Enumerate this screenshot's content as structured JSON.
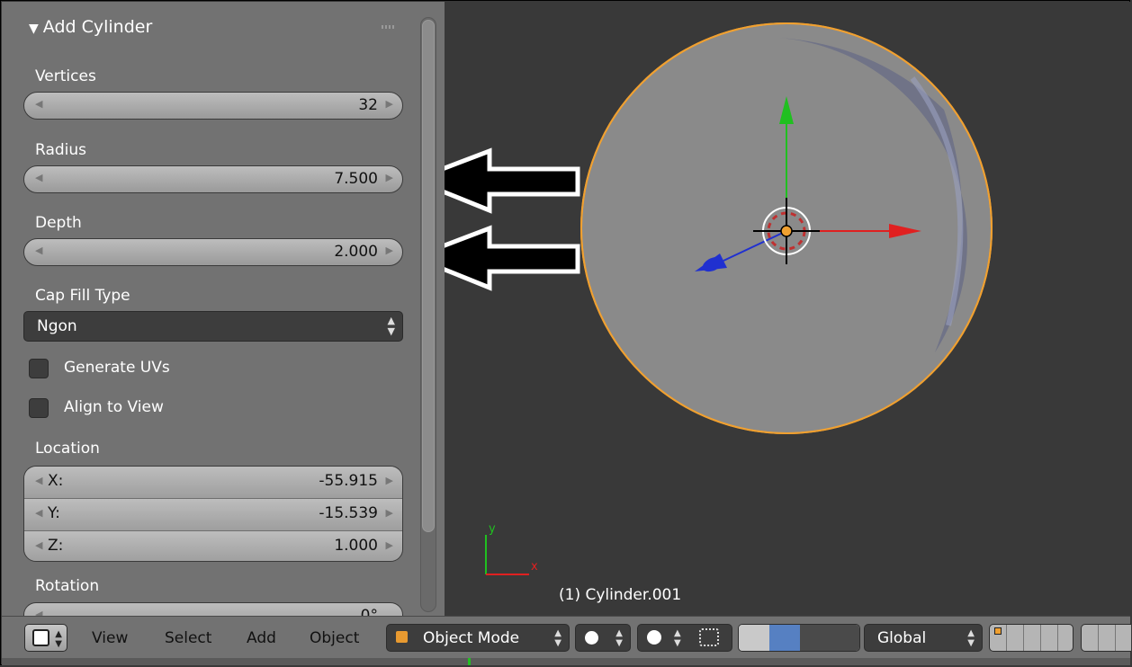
{
  "panel": {
    "title": "Add Cylinder",
    "vertices_label": "Vertices",
    "vertices_value": "32",
    "radius_label": "Radius",
    "radius_value": "7.500",
    "depth_label": "Depth",
    "depth_value": "2.000",
    "cap_fill_label": "Cap Fill Type",
    "cap_fill_value": "Ngon",
    "generate_uvs_label": "Generate UVs",
    "generate_uvs_checked": false,
    "align_to_view_label": "Align to View",
    "align_to_view_checked": false,
    "location_label": "Location",
    "location": [
      {
        "axis": "X:",
        "value": "-55.915"
      },
      {
        "axis": "Y:",
        "value": "-15.539"
      },
      {
        "axis": "Z:",
        "value": "1.000"
      }
    ],
    "rotation_label": "Rotation",
    "rotation_x_partial": "0°"
  },
  "viewport": {
    "object_label": "(1) Cylinder.001",
    "axis_y": "y",
    "axis_x": "x",
    "colors": {
      "background": "#393939",
      "cylinder": "#8a8a8a",
      "outline": "#f0a030",
      "x_axis": "#e02020",
      "y_axis": "#20c020",
      "z_axis": "#2030d0"
    }
  },
  "header": {
    "menus": [
      "View",
      "Select",
      "Add",
      "Object"
    ],
    "mode": "Object Mode",
    "orientation": "Global"
  }
}
